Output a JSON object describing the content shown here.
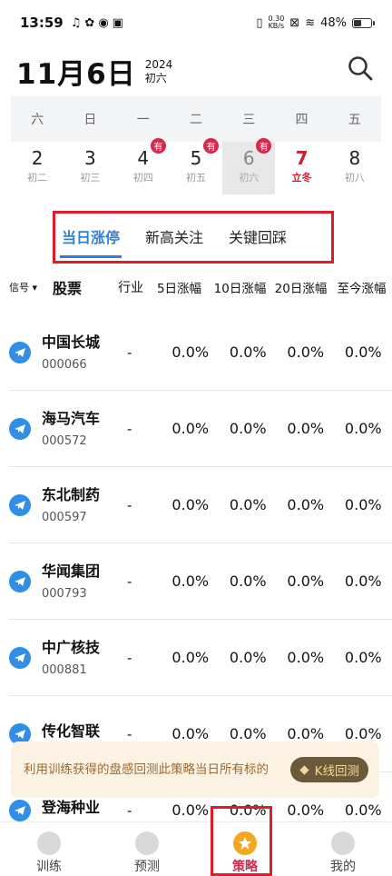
{
  "status_bar": {
    "time": "13:59",
    "net_speed_value": "0.30",
    "net_speed_unit": "KB/s",
    "battery": "48%",
    "battery_level": 0.48
  },
  "date_header": {
    "date": "11月6日",
    "year": "2024",
    "lunar": "初六"
  },
  "calendar": {
    "weekdays": [
      "六",
      "日",
      "一",
      "二",
      "三",
      "四",
      "五"
    ],
    "days": [
      {
        "num": "2",
        "lunar": "初二"
      },
      {
        "num": "3",
        "lunar": "初三"
      },
      {
        "num": "4",
        "lunar": "初四",
        "badge": "有"
      },
      {
        "num": "5",
        "lunar": "初五",
        "badge": "有"
      },
      {
        "num": "6",
        "lunar": "初六",
        "badge": "有"
      },
      {
        "num": "7",
        "lunar": "立冬"
      },
      {
        "num": "8",
        "lunar": "初八"
      }
    ]
  },
  "tabs": [
    "当日涨停",
    "新高关注",
    "关键回踩"
  ],
  "table": {
    "headers": {
      "signal": "信号",
      "stock": "股票",
      "industry": "行业",
      "d5": "5日涨幅",
      "d10": "10日涨幅",
      "d20": "20日涨幅",
      "now": "至今涨幅"
    },
    "rows": [
      {
        "name": "中国长城",
        "code": "000066",
        "industry": "-",
        "d5": "0.0%",
        "d10": "0.0%",
        "d20": "0.0%",
        "now": "0.0%"
      },
      {
        "name": "海马汽车",
        "code": "000572",
        "industry": "-",
        "d5": "0.0%",
        "d10": "0.0%",
        "d20": "0.0%",
        "now": "0.0%"
      },
      {
        "name": "东北制药",
        "code": "000597",
        "industry": "-",
        "d5": "0.0%",
        "d10": "0.0%",
        "d20": "0.0%",
        "now": "0.0%"
      },
      {
        "name": "华闻集团",
        "code": "000793",
        "industry": "-",
        "d5": "0.0%",
        "d10": "0.0%",
        "d20": "0.0%",
        "now": "0.0%"
      },
      {
        "name": "中广核技",
        "code": "000881",
        "industry": "-",
        "d5": "0.0%",
        "d10": "0.0%",
        "d20": "0.0%",
        "now": "0.0%"
      },
      {
        "name": "传化智联",
        "code": "",
        "industry": "-",
        "d5": "0.0%",
        "d10": "0.0%",
        "d20": "0.0%",
        "now": "0.0%"
      },
      {
        "name": "登海种业",
        "code": "",
        "industry": "-",
        "d5": "0.0%",
        "d10": "0.0%",
        "d20": "0.0%",
        "now": "0.0%"
      }
    ]
  },
  "banner": {
    "text": "利用训练获得的盘感回测此策略当日所有标的",
    "button": "K线回测"
  },
  "bottom_nav": [
    "训练",
    "预测",
    "策略",
    "我的"
  ],
  "colors": {
    "accent_blue": "#2f7fd6",
    "active_red": "#d6284b",
    "holiday_red": "#d01e2e",
    "highlight_box": "#e01b2a"
  }
}
